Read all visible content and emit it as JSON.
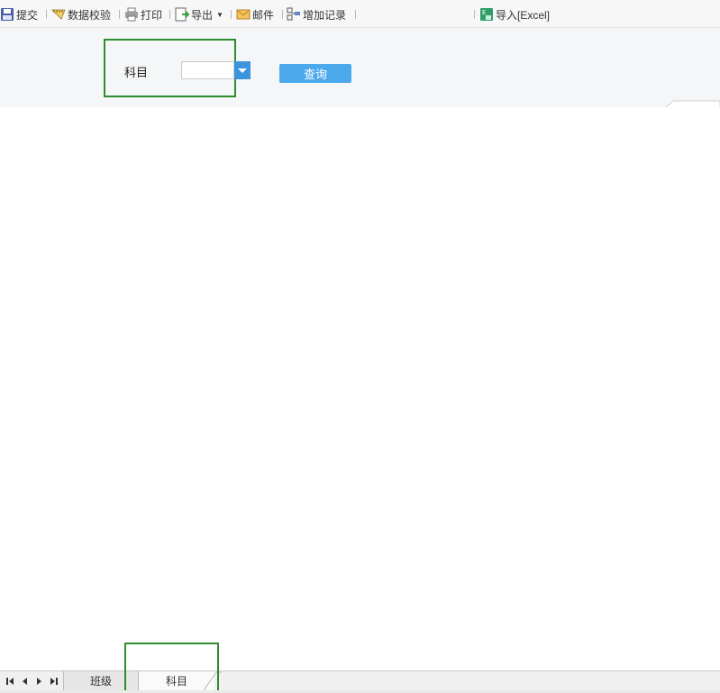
{
  "toolbar": {
    "submit": "提交",
    "data_validation": "数据校验",
    "print": "打印",
    "export": "导出",
    "email": "邮件",
    "add_record": "增加记录",
    "import_excel": "导入[Excel]"
  },
  "filter": {
    "subject_label": "科目",
    "subject_value": "",
    "query_button": "查询"
  },
  "sheets": {
    "tabs": [
      "班级",
      "科目"
    ],
    "active": "科目"
  },
  "colors": {
    "highlight": "#2e8b2e",
    "accent": "#4ba9ec",
    "dropdown": "#3c94dd"
  }
}
